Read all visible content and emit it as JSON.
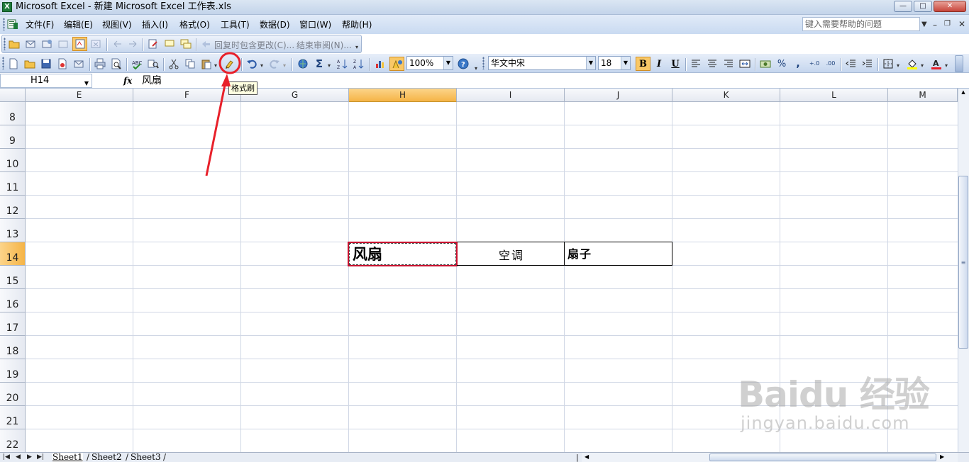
{
  "window": {
    "title": "Microsoft Excel - 新建 Microsoft Excel 工作表.xls",
    "app_icon": "excel-icon"
  },
  "menu": {
    "items": [
      "文件(F)",
      "编辑(E)",
      "视图(V)",
      "插入(I)",
      "格式(O)",
      "工具(T)",
      "数据(D)",
      "窗口(W)",
      "帮助(H)"
    ],
    "help_placeholder": "键入需要帮助的问题"
  },
  "review_toolbar": {
    "reply_label": "回复时包含更改(C)...",
    "end_review_label": "结束审阅(N)..."
  },
  "standard_toolbar": {
    "zoom": "100%",
    "font_name": "华文中宋",
    "font_size": "18",
    "bold_active": true
  },
  "tooltip": {
    "text": "格式刷"
  },
  "formula_bar": {
    "name_box": "H14",
    "fx": "fx",
    "content": "风扇"
  },
  "grid": {
    "columns": [
      "E",
      "F",
      "G",
      "H",
      "I",
      "J",
      "K",
      "L",
      "M"
    ],
    "active_column": "H",
    "rows": [
      "8",
      "9",
      "10",
      "11",
      "12",
      "13",
      "14",
      "15",
      "16",
      "17",
      "18",
      "19",
      "20",
      "21",
      "22"
    ],
    "active_row": "14",
    "cells": {
      "H14": "风扇",
      "I14": "空调",
      "J14": "扇子"
    }
  },
  "sheets": {
    "tabs": [
      "Sheet1",
      "Sheet2",
      "Sheet3"
    ],
    "active": "Sheet1"
  },
  "watermark": {
    "logo": "Baidu 经验",
    "url": "jingyan.baidu.com"
  },
  "colors": {
    "selection_border": "#c8102e",
    "active_header": "#f5b446",
    "annotation_red": "#e8202a"
  }
}
